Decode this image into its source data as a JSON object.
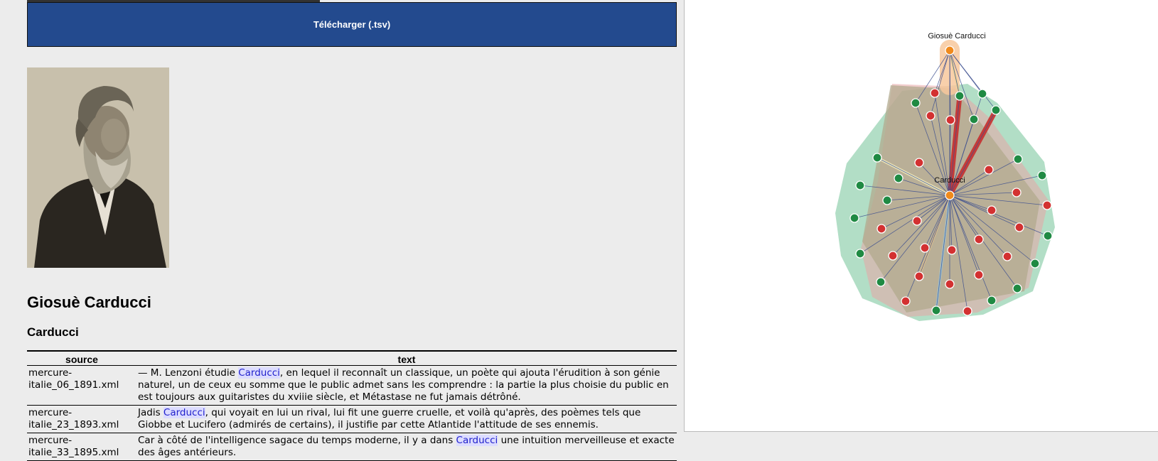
{
  "download_button": {
    "label": "Télécharger (.tsv)"
  },
  "person": {
    "name": "Giosuè Carducci"
  },
  "form": {
    "label": "Carducci"
  },
  "table": {
    "headers": [
      "source",
      "text"
    ],
    "rows": [
      {
        "source": "mercure-italie_06_1891.xml",
        "text_before": "— M. Lenzoni étudie ",
        "highlight": "Carducci",
        "text_after": ", en lequel il reconnaît un classique, un poète qui ajouta l'érudition à son génie naturel, un de ceux eu somme que le public admet sans les comprendre : la partie la plus choisie du public en est toujours aux guitaristes du xviiie siècle, et Métastase ne fut jamais détrôné."
      },
      {
        "source": "mercure-italie_23_1893.xml",
        "text_before": "Jadis ",
        "highlight": "Carducci",
        "text_after": ", qui voyait en lui un rival, lui fit une guerre cruelle, et voilà qu'après, des poèmes tels que Giobbe et Lucifero (admirés de certains), il justifie par cette Atlantide l'attitude de ses ennemis."
      },
      {
        "source": "mercure-italie_33_1895.xml",
        "text_before": "Car à côté de l'intelligence sagace du temps moderne, il y a dans ",
        "highlight": "Carducci",
        "text_after": " une intuition merveilleuse et exacte des âges antérieurs."
      }
    ]
  },
  "graph": {
    "top_node_label": "Giosuè Carducci",
    "center_node_label": "Carducci",
    "colors": {
      "green_node": "#1f8a43",
      "red_node": "#d33131",
      "orange_node": "#f08a1c",
      "green_hull": "#9fd6b8",
      "red_hull": "#e8a5a5",
      "edge": "#3d4f8f"
    }
  }
}
